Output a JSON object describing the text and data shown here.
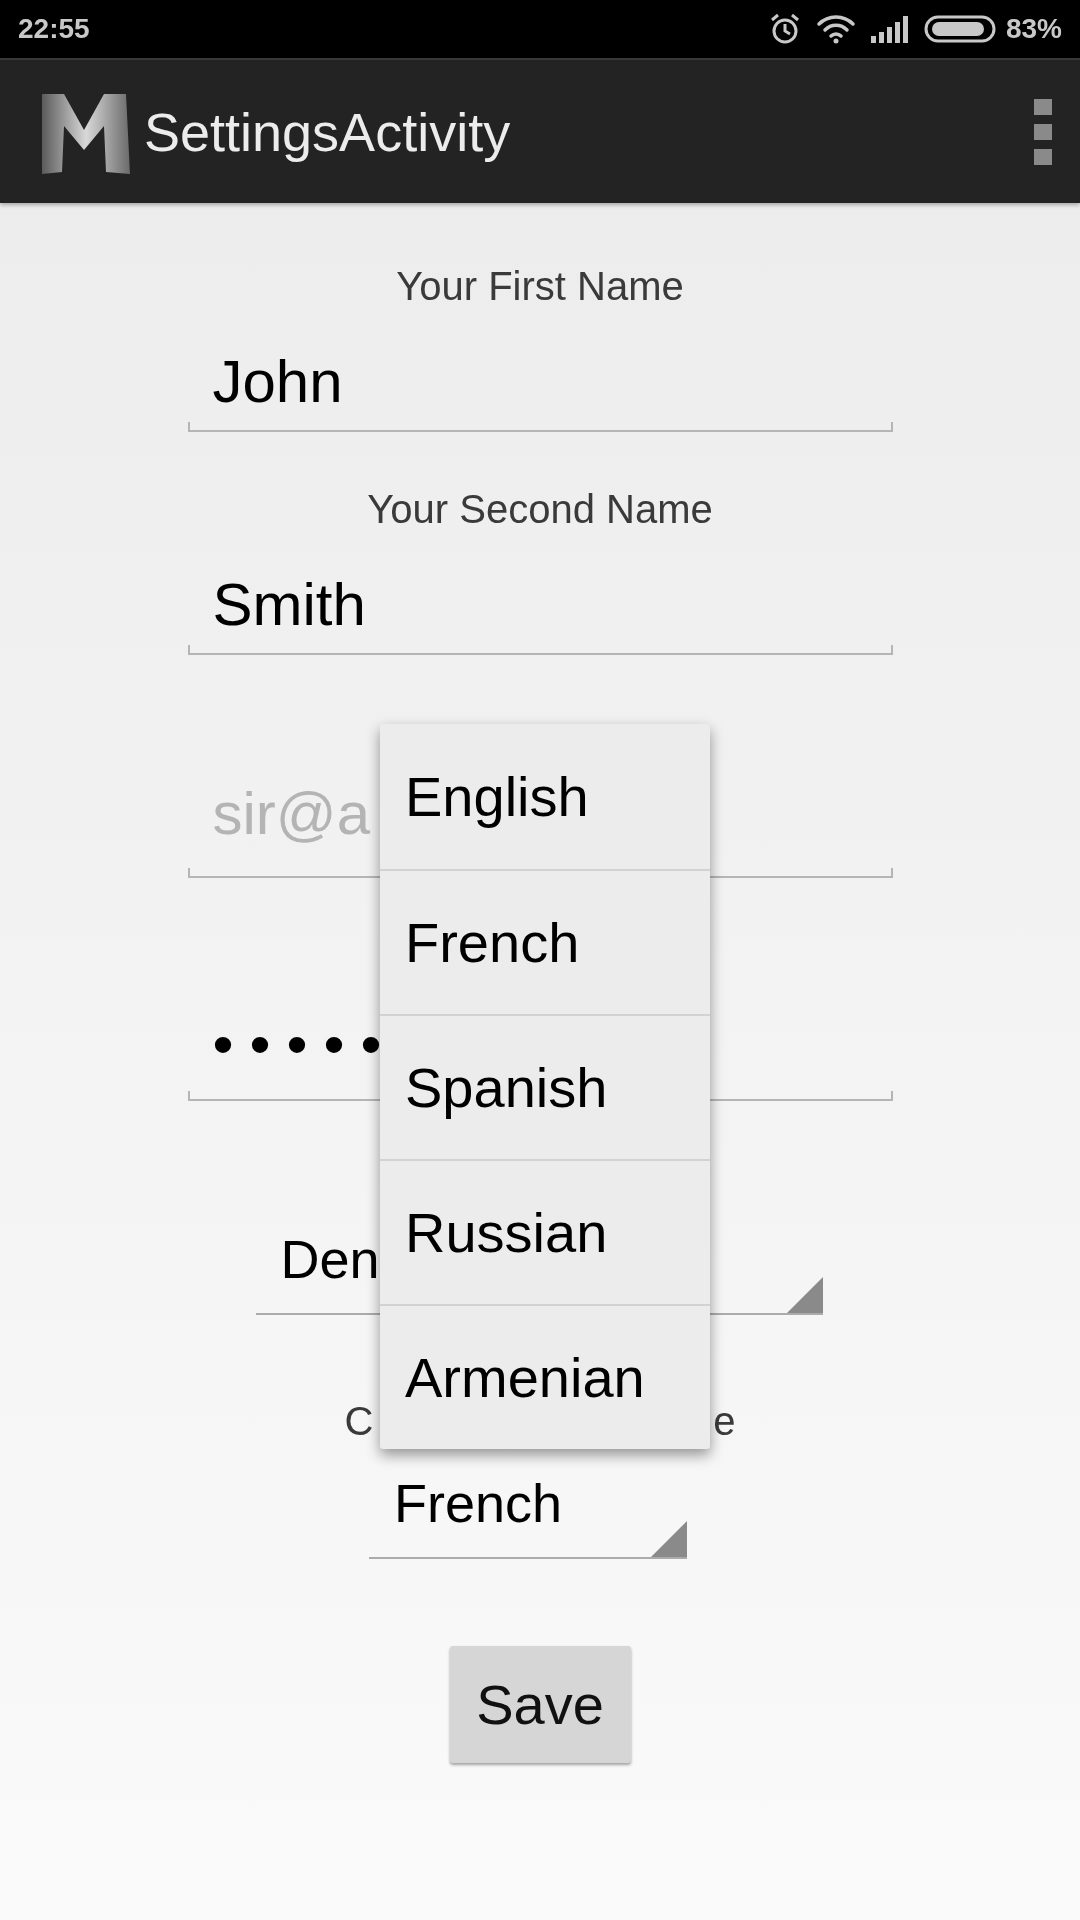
{
  "status_bar": {
    "time": "22:55",
    "battery": "83%"
  },
  "app_bar": {
    "title": "SettingsActivity"
  },
  "form": [
    {
      "kind": "text",
      "label": "Your First Name",
      "value": "John"
    },
    {
      "kind": "text",
      "label": "Your Second Name",
      "value": "Smith"
    },
    {
      "kind": "text",
      "placeholder": "sir@a"
    },
    {
      "kind": "password",
      "value": "•••••"
    },
    {
      "kind": "wide_spinner",
      "value": "Den"
    },
    {
      "kind": "split_label",
      "left": "C",
      "right": "e"
    },
    {
      "kind": "spinner",
      "value": "French"
    }
  ],
  "dropdown": {
    "items": [
      "English",
      "French",
      "Spanish",
      "Russian",
      "Armenian"
    ]
  },
  "save_button": "Save"
}
